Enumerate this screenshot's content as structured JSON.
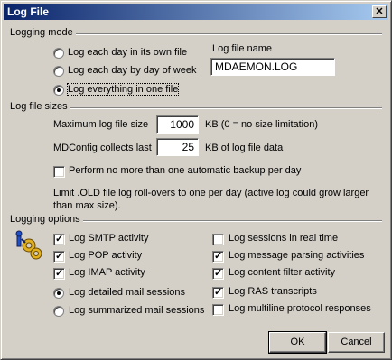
{
  "window": {
    "title": "Log File",
    "close_glyph": "✕"
  },
  "logging_mode": {
    "heading": "Logging mode",
    "options": [
      {
        "label": "Log each day in its own file",
        "checked": false
      },
      {
        "label": "Log each day by day of week",
        "checked": false
      },
      {
        "label": "Log everything in one file",
        "checked": true
      }
    ],
    "file_name_label": "Log file name",
    "file_name_value": "MDAEMON.LOG"
  },
  "log_file_sizes": {
    "heading": "Log file sizes",
    "max_size_label": "Maximum log file size",
    "max_size_value": "1000",
    "max_size_suffix": "KB (0 = no size limitation)",
    "mdconfig_label": "MDConfig collects last",
    "mdconfig_value": "25",
    "mdconfig_suffix": "KB of log file data",
    "backup_label": "Perform no more than one automatic backup per day",
    "backup_checked": false,
    "note_line1": "Limit .OLD file log roll-overs to one per day (active log could grow larger",
    "note_line2": "than max size)."
  },
  "logging_options": {
    "heading": "Logging options",
    "icon": "gears-icon",
    "left": [
      {
        "label": "Log SMTP activity",
        "type": "check",
        "checked": true
      },
      {
        "label": "Log POP activity",
        "type": "check",
        "checked": true
      },
      {
        "label": "Log IMAP activity",
        "type": "check",
        "checked": true
      },
      {
        "label": "Log detailed mail sessions",
        "type": "radio",
        "checked": true
      },
      {
        "label": "Log summarized mail sessions",
        "type": "radio",
        "checked": false
      }
    ],
    "right": [
      {
        "label": "Log sessions in real time",
        "checked": false
      },
      {
        "label": "Log message parsing activities",
        "checked": true
      },
      {
        "label": "Log content filter activity",
        "checked": true
      },
      {
        "label": "Log RAS transcripts",
        "checked": true
      },
      {
        "label": "Log multiline protocol responses",
        "checked": false
      }
    ]
  },
  "buttons": {
    "ok": "OK",
    "cancel": "Cancel"
  }
}
